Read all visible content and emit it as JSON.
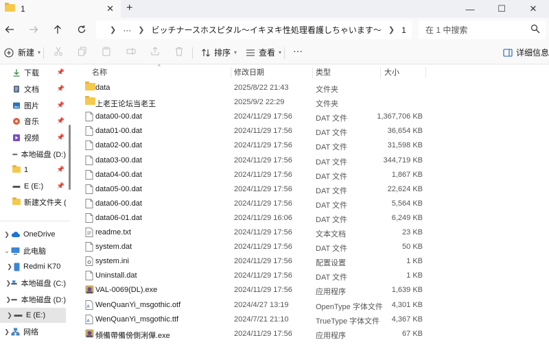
{
  "window": {
    "tab_title": "1",
    "tab_close": "✕",
    "new_tab": "+",
    "minimize": "—",
    "maximize": "☐",
    "close": "✕"
  },
  "address": {
    "more": "···",
    "crumbs": [
      "ビッチナースホスピタル～イキヌキ性処理看護しちゃいます～",
      "1"
    ],
    "search_placeholder": "在 1 中搜索"
  },
  "commands": {
    "new": "新建",
    "sort": "排序",
    "view": "查看",
    "more": "···",
    "details": "详细信息"
  },
  "sidebar": {
    "quick": [
      {
        "label": "下载",
        "icon": "download-icon"
      },
      {
        "label": "文档",
        "icon": "document-icon"
      },
      {
        "label": "图片",
        "icon": "pictures-icon"
      },
      {
        "label": "音乐",
        "icon": "music-icon"
      },
      {
        "label": "视频",
        "icon": "video-icon"
      },
      {
        "label": "本地磁盘 (D:)",
        "icon": "drive-icon"
      },
      {
        "label": "1",
        "icon": "folder-icon"
      },
      {
        "label": "E (E:)",
        "icon": "drive-icon"
      },
      {
        "label": "新建文件夹 (",
        "icon": "folder-icon"
      }
    ],
    "tree": [
      {
        "label": "OneDrive",
        "icon": "cloud-icon"
      },
      {
        "label": "此电脑",
        "icon": "computer-icon"
      },
      {
        "label": "Redmi K70",
        "icon": "phone-icon"
      },
      {
        "label": "本地磁盘 (C:)",
        "icon": "drive-icon"
      },
      {
        "label": "本地磁盘 (D:)",
        "icon": "drive-icon"
      },
      {
        "label": "E (E:)",
        "icon": "drive-icon"
      },
      {
        "label": "网络",
        "icon": "network-icon"
      }
    ]
  },
  "columns": {
    "name": "名称",
    "date": "修改日期",
    "type": "类型",
    "size": "大小"
  },
  "files": [
    {
      "name": "data",
      "date": "2025/8/22 21:43",
      "type": "文件夹",
      "size": "",
      "icon": "folder-icon"
    },
    {
      "name": "上老王论坛当老王",
      "date": "2025/9/2 22:29",
      "type": "文件夹",
      "size": "",
      "icon": "folder-icon"
    },
    {
      "name": "data00-00.dat",
      "date": "2024/11/29 17:56",
      "type": "DAT 文件",
      "size": "1,367,706 KB",
      "icon": "file-icon"
    },
    {
      "name": "data01-00.dat",
      "date": "2024/11/29 17:56",
      "type": "DAT 文件",
      "size": "36,654 KB",
      "icon": "file-icon"
    },
    {
      "name": "data02-00.dat",
      "date": "2024/11/29 17:56",
      "type": "DAT 文件",
      "size": "31,598 KB",
      "icon": "file-icon"
    },
    {
      "name": "data03-00.dat",
      "date": "2024/11/29 17:56",
      "type": "DAT 文件",
      "size": "344,719 KB",
      "icon": "file-icon"
    },
    {
      "name": "data04-00.dat",
      "date": "2024/11/29 17:56",
      "type": "DAT 文件",
      "size": "1,867 KB",
      "icon": "file-icon"
    },
    {
      "name": "data05-00.dat",
      "date": "2024/11/29 17:56",
      "type": "DAT 文件",
      "size": "22,624 KB",
      "icon": "file-icon"
    },
    {
      "name": "data06-00.dat",
      "date": "2024/11/29 17:56",
      "type": "DAT 文件",
      "size": "5,564 KB",
      "icon": "file-icon"
    },
    {
      "name": "data06-01.dat",
      "date": "2024/11/29 16:06",
      "type": "DAT 文件",
      "size": "6,249 KB",
      "icon": "file-icon"
    },
    {
      "name": "readme.txt",
      "date": "2024/11/29 17:56",
      "type": "文本文档",
      "size": "23 KB",
      "icon": "text-file-icon"
    },
    {
      "name": "system.dat",
      "date": "2024/11/29 17:56",
      "type": "DAT 文件",
      "size": "50 KB",
      "icon": "file-icon"
    },
    {
      "name": "system.ini",
      "date": "2024/11/29 17:56",
      "type": "配置设置",
      "size": "1 KB",
      "icon": "settings-file-icon"
    },
    {
      "name": "Uninstall.dat",
      "date": "2024/11/29 17:56",
      "type": "DAT 文件",
      "size": "1 KB",
      "icon": "file-icon"
    },
    {
      "name": "VAL-0069(DL).exe",
      "date": "2024/11/29 17:56",
      "type": "应用程序",
      "size": "1,639 KB",
      "icon": "app-icon"
    },
    {
      "name": "WenQuanYi_msgothic.otf",
      "date": "2024/4/27 13:19",
      "type": "OpenType 字体文件",
      "size": "4,301 KB",
      "icon": "font-file-icon"
    },
    {
      "name": "WenQuanYi_msgothic.ttf",
      "date": "2024/7/21 21:10",
      "type": "TrueType 字体文件",
      "size": "4,367 KB",
      "icon": "font-file-icon"
    },
    {
      "name": "傾備帶備傍側浰僤.exe",
      "date": "2024/11/29 17:56",
      "type": "应用程序",
      "size": "67 KB",
      "icon": "app-icon"
    }
  ]
}
